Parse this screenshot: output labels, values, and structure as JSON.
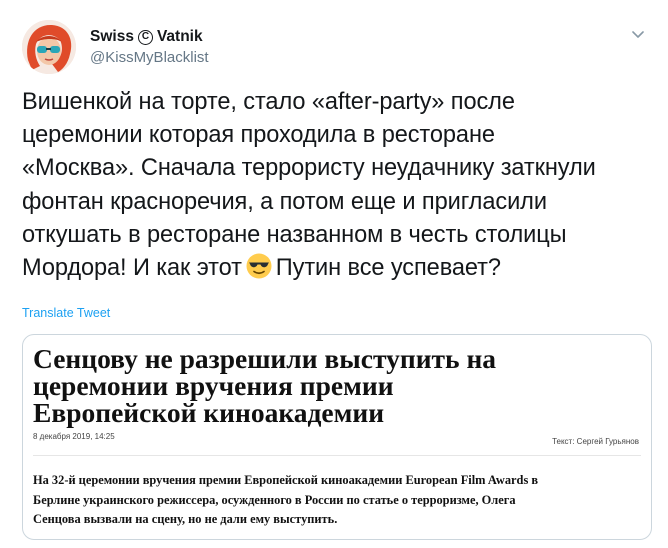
{
  "author": {
    "name_part1": "Swiss",
    "copyright_symbol": "C",
    "name_part2": "Vatnik",
    "handle": "@KissMyBlacklist"
  },
  "tweet": {
    "lines": [
      "Вишенкой на торте, стало «after-party» после",
      "церемонии которая проходила в ресторане",
      "«Москва». Сначала террористу неудачнику заткнули",
      "фонтан красноречия, а потом еще и пригласили",
      "откушать в ресторане названном в честь столицы"
    ],
    "last_line_before_emoji": "Мордора! И как этот",
    "emoji": "smiling-face-with-sunglasses",
    "last_line_after_emoji": "Путин все успевает?"
  },
  "translate_label": "Translate Tweet",
  "card": {
    "headline": [
      "Сенцову не разрешили выступить на",
      "церемонии вручения премии",
      "Европейской киноакадемии"
    ],
    "date": "8 декабря 2019, 14:25",
    "credit": "Текст: Сергей Гурьянов",
    "lede": [
      "На 32-й церемонии вручения премии Европейской киноакадемии European Film Awards в",
      "Берлине украинского режиссера, осужденного в России по статье о терроризме, Олега",
      "Сенцова вызвали на сцену, но не дали ему выступить."
    ]
  },
  "colors": {
    "link": "#1da1f2",
    "secondary_text": "#657786",
    "border": "#ccd6dd"
  }
}
